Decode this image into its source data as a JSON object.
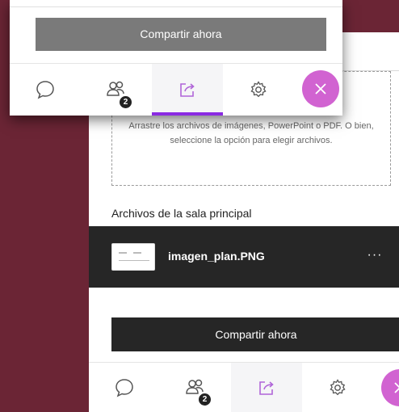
{
  "dropzone": {
    "instructions": "Arrastre los archivos de imágenes, PowerPoint o PDF. O bien, seleccione la opción para elegir archivos."
  },
  "files": {
    "heading": "Archivos de la sala principal",
    "items": [
      {
        "name": "imagen_plan.PNG",
        "more_label": "···"
      }
    ]
  },
  "share_button_label": "Compartir ahora",
  "popup": {
    "share_button_label": "Compartir ahora"
  },
  "tabs": {
    "chat_icon": "chat-bubble-icon",
    "attendees_icon": "attendees-icon",
    "attendees_badge": "2",
    "share_icon": "share-content-icon",
    "settings_icon": "gear-icon",
    "close_icon": "close-icon"
  },
  "colors": {
    "background": "#6b2535",
    "accent": "#8a2be2",
    "close_button": "#d163d1",
    "dark_button": "#262626",
    "disabled_button": "#7a7a7a"
  }
}
